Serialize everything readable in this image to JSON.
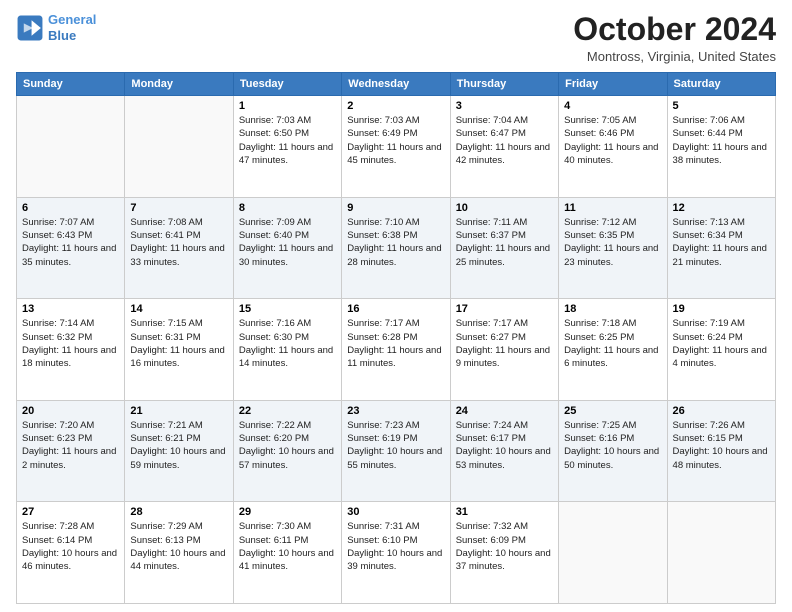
{
  "header": {
    "logo_line1": "General",
    "logo_line2": "Blue",
    "title": "October 2024",
    "subtitle": "Montross, Virginia, United States"
  },
  "days_of_week": [
    "Sunday",
    "Monday",
    "Tuesday",
    "Wednesday",
    "Thursday",
    "Friday",
    "Saturday"
  ],
  "weeks": [
    [
      {
        "num": "",
        "sunrise": "",
        "sunset": "",
        "daylight": ""
      },
      {
        "num": "",
        "sunrise": "",
        "sunset": "",
        "daylight": ""
      },
      {
        "num": "1",
        "sunrise": "Sunrise: 7:03 AM",
        "sunset": "Sunset: 6:50 PM",
        "daylight": "Daylight: 11 hours and 47 minutes."
      },
      {
        "num": "2",
        "sunrise": "Sunrise: 7:03 AM",
        "sunset": "Sunset: 6:49 PM",
        "daylight": "Daylight: 11 hours and 45 minutes."
      },
      {
        "num": "3",
        "sunrise": "Sunrise: 7:04 AM",
        "sunset": "Sunset: 6:47 PM",
        "daylight": "Daylight: 11 hours and 42 minutes."
      },
      {
        "num": "4",
        "sunrise": "Sunrise: 7:05 AM",
        "sunset": "Sunset: 6:46 PM",
        "daylight": "Daylight: 11 hours and 40 minutes."
      },
      {
        "num": "5",
        "sunrise": "Sunrise: 7:06 AM",
        "sunset": "Sunset: 6:44 PM",
        "daylight": "Daylight: 11 hours and 38 minutes."
      }
    ],
    [
      {
        "num": "6",
        "sunrise": "Sunrise: 7:07 AM",
        "sunset": "Sunset: 6:43 PM",
        "daylight": "Daylight: 11 hours and 35 minutes."
      },
      {
        "num": "7",
        "sunrise": "Sunrise: 7:08 AM",
        "sunset": "Sunset: 6:41 PM",
        "daylight": "Daylight: 11 hours and 33 minutes."
      },
      {
        "num": "8",
        "sunrise": "Sunrise: 7:09 AM",
        "sunset": "Sunset: 6:40 PM",
        "daylight": "Daylight: 11 hours and 30 minutes."
      },
      {
        "num": "9",
        "sunrise": "Sunrise: 7:10 AM",
        "sunset": "Sunset: 6:38 PM",
        "daylight": "Daylight: 11 hours and 28 minutes."
      },
      {
        "num": "10",
        "sunrise": "Sunrise: 7:11 AM",
        "sunset": "Sunset: 6:37 PM",
        "daylight": "Daylight: 11 hours and 25 minutes."
      },
      {
        "num": "11",
        "sunrise": "Sunrise: 7:12 AM",
        "sunset": "Sunset: 6:35 PM",
        "daylight": "Daylight: 11 hours and 23 minutes."
      },
      {
        "num": "12",
        "sunrise": "Sunrise: 7:13 AM",
        "sunset": "Sunset: 6:34 PM",
        "daylight": "Daylight: 11 hours and 21 minutes."
      }
    ],
    [
      {
        "num": "13",
        "sunrise": "Sunrise: 7:14 AM",
        "sunset": "Sunset: 6:32 PM",
        "daylight": "Daylight: 11 hours and 18 minutes."
      },
      {
        "num": "14",
        "sunrise": "Sunrise: 7:15 AM",
        "sunset": "Sunset: 6:31 PM",
        "daylight": "Daylight: 11 hours and 16 minutes."
      },
      {
        "num": "15",
        "sunrise": "Sunrise: 7:16 AM",
        "sunset": "Sunset: 6:30 PM",
        "daylight": "Daylight: 11 hours and 14 minutes."
      },
      {
        "num": "16",
        "sunrise": "Sunrise: 7:17 AM",
        "sunset": "Sunset: 6:28 PM",
        "daylight": "Daylight: 11 hours and 11 minutes."
      },
      {
        "num": "17",
        "sunrise": "Sunrise: 7:17 AM",
        "sunset": "Sunset: 6:27 PM",
        "daylight": "Daylight: 11 hours and 9 minutes."
      },
      {
        "num": "18",
        "sunrise": "Sunrise: 7:18 AM",
        "sunset": "Sunset: 6:25 PM",
        "daylight": "Daylight: 11 hours and 6 minutes."
      },
      {
        "num": "19",
        "sunrise": "Sunrise: 7:19 AM",
        "sunset": "Sunset: 6:24 PM",
        "daylight": "Daylight: 11 hours and 4 minutes."
      }
    ],
    [
      {
        "num": "20",
        "sunrise": "Sunrise: 7:20 AM",
        "sunset": "Sunset: 6:23 PM",
        "daylight": "Daylight: 11 hours and 2 minutes."
      },
      {
        "num": "21",
        "sunrise": "Sunrise: 7:21 AM",
        "sunset": "Sunset: 6:21 PM",
        "daylight": "Daylight: 10 hours and 59 minutes."
      },
      {
        "num": "22",
        "sunrise": "Sunrise: 7:22 AM",
        "sunset": "Sunset: 6:20 PM",
        "daylight": "Daylight: 10 hours and 57 minutes."
      },
      {
        "num": "23",
        "sunrise": "Sunrise: 7:23 AM",
        "sunset": "Sunset: 6:19 PM",
        "daylight": "Daylight: 10 hours and 55 minutes."
      },
      {
        "num": "24",
        "sunrise": "Sunrise: 7:24 AM",
        "sunset": "Sunset: 6:17 PM",
        "daylight": "Daylight: 10 hours and 53 minutes."
      },
      {
        "num": "25",
        "sunrise": "Sunrise: 7:25 AM",
        "sunset": "Sunset: 6:16 PM",
        "daylight": "Daylight: 10 hours and 50 minutes."
      },
      {
        "num": "26",
        "sunrise": "Sunrise: 7:26 AM",
        "sunset": "Sunset: 6:15 PM",
        "daylight": "Daylight: 10 hours and 48 minutes."
      }
    ],
    [
      {
        "num": "27",
        "sunrise": "Sunrise: 7:28 AM",
        "sunset": "Sunset: 6:14 PM",
        "daylight": "Daylight: 10 hours and 46 minutes."
      },
      {
        "num": "28",
        "sunrise": "Sunrise: 7:29 AM",
        "sunset": "Sunset: 6:13 PM",
        "daylight": "Daylight: 10 hours and 44 minutes."
      },
      {
        "num": "29",
        "sunrise": "Sunrise: 7:30 AM",
        "sunset": "Sunset: 6:11 PM",
        "daylight": "Daylight: 10 hours and 41 minutes."
      },
      {
        "num": "30",
        "sunrise": "Sunrise: 7:31 AM",
        "sunset": "Sunset: 6:10 PM",
        "daylight": "Daylight: 10 hours and 39 minutes."
      },
      {
        "num": "31",
        "sunrise": "Sunrise: 7:32 AM",
        "sunset": "Sunset: 6:09 PM",
        "daylight": "Daylight: 10 hours and 37 minutes."
      },
      {
        "num": "",
        "sunrise": "",
        "sunset": "",
        "daylight": ""
      },
      {
        "num": "",
        "sunrise": "",
        "sunset": "",
        "daylight": ""
      }
    ]
  ]
}
